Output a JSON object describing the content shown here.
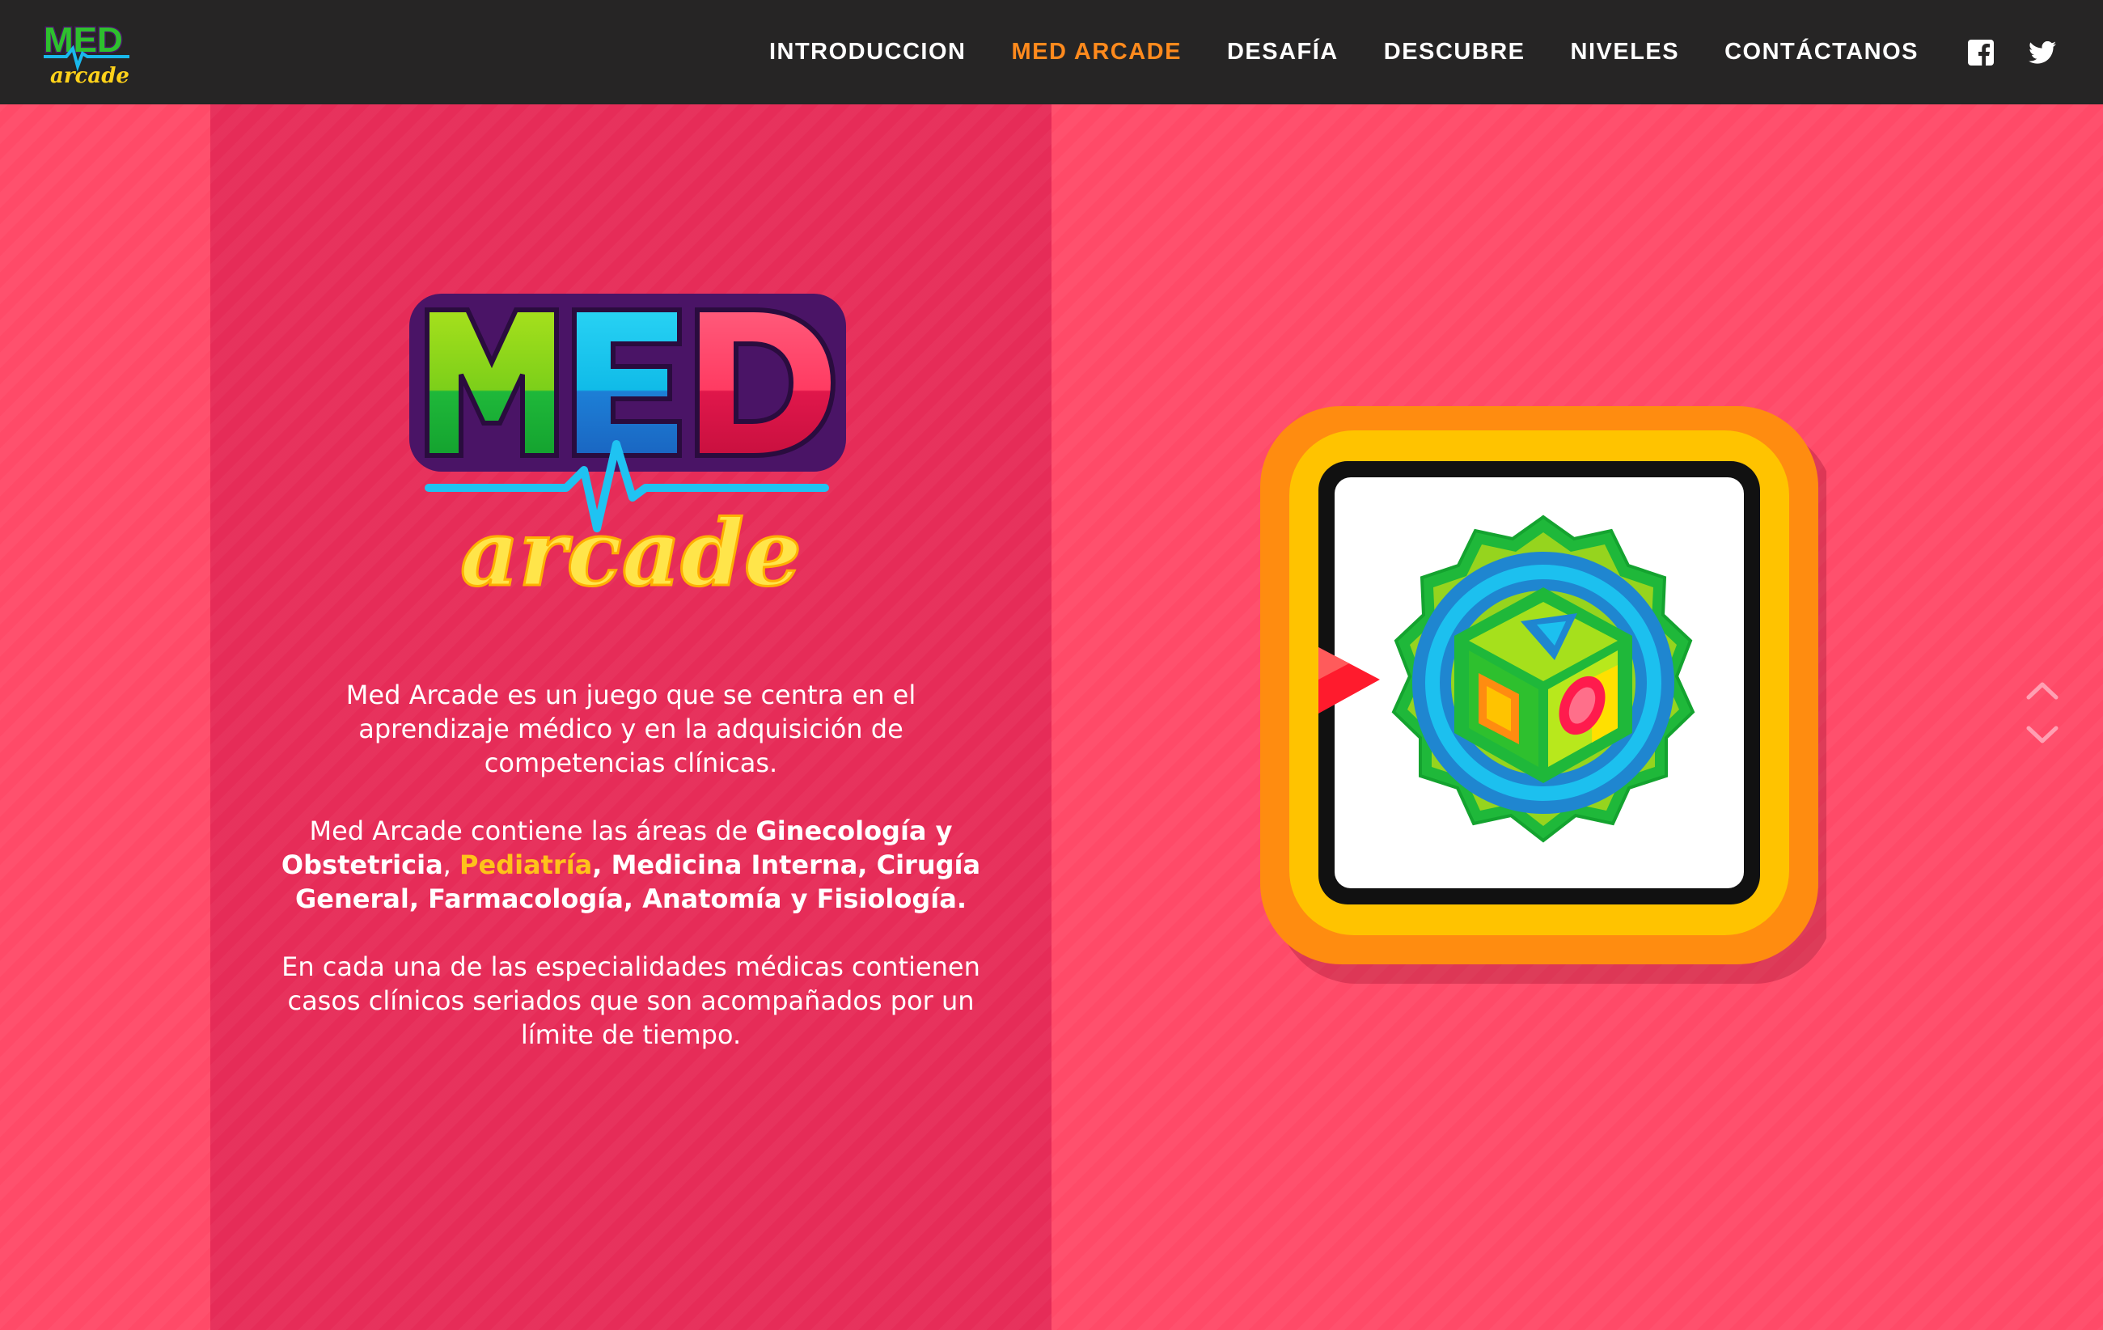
{
  "brand": {
    "logo_alt": "Med Arcade",
    "logo_top": "MED",
    "logo_bottom": "arcade"
  },
  "nav": {
    "items": [
      {
        "label": "INTRODUCCION",
        "active": false
      },
      {
        "label": "MED ARCADE",
        "active": true
      },
      {
        "label": "DESAFÍA",
        "active": false
      },
      {
        "label": "DESCUBRE",
        "active": false
      },
      {
        "label": "NIVELES",
        "active": false
      },
      {
        "label": "CONTÁCTANOS",
        "active": false
      }
    ],
    "social": [
      {
        "icon": "facebook-icon"
      },
      {
        "icon": "twitter-icon"
      }
    ]
  },
  "hero": {
    "logo_top": "MED",
    "logo_bottom": "arcade"
  },
  "description": {
    "p1": "Med Arcade es un juego que se centra en el aprendizaje médico y en la adquisición de competencias clínicas.",
    "p2_intro": "Med Arcade contiene las áreas de ",
    "areas": {
      "a1": "Ginecología y Obstetricia",
      "sep1": ", ",
      "a2": "Pediatría",
      "sep2": ", ",
      "a3": "Medicina Interna",
      "sep3": ", ",
      "a4": "Cirugía General",
      "sep4": ", ",
      "a5": "Farmacología",
      "sep5": ", ",
      "a6": "Anatomía y Fisiología",
      "end": "."
    },
    "p3": "En cada una de las especialidades médicas contienen casos clínicos seriados que son acompañados por un límite de tiempo."
  },
  "badge": {
    "icon": "dice-badge-icon"
  },
  "colors": {
    "navbar_bg": "#262525",
    "nav_active": "#ff8a1d",
    "page_bg": "#ff4a68",
    "panel_bg": "#e62c58",
    "highlight": "#ffc21a"
  }
}
